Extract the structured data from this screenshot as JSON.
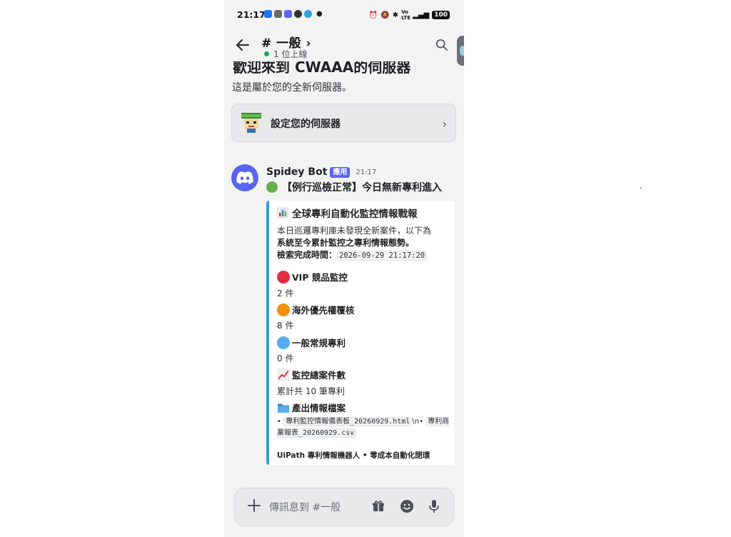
{
  "status_bar": {
    "time": "21:17",
    "battery": "100",
    "signal_text": "Vo LTE",
    "app_colors": [
      "#1877f2",
      "#6b6b6b",
      "#5865f2",
      "#333333",
      "#2aa3e3"
    ]
  },
  "header": {
    "channel": "# 一般 ›",
    "online": "1 位上線"
  },
  "welcome": {
    "title": "歡迎來到 CWAAA的伺服器",
    "subtitle": "這是屬於您的全新伺服器。",
    "setup_label": "設定您的伺服器",
    "setup_chevron": "›"
  },
  "message": {
    "author": "Spidey Bot",
    "badge": "應用",
    "time": "21:17",
    "content": "【例行巡檢正常】今日無新專利進入",
    "status_color": "#6aaf4e"
  },
  "embed": {
    "title": "全球專利自動化監控情報戰報",
    "desc_line1": "本日巡邏專利庫未發現全新案件，以下為",
    "desc_line2": "系統至今累計監控之專利情報態勢。",
    "search_time_label": "檢索完成時間：",
    "search_time_value": "2026-09-29 21:17:20",
    "fields": [
      {
        "name": "VIP 競品監控",
        "value": "2 件",
        "color": "#dd2e44"
      },
      {
        "name": "海外優先權覆核",
        "value": "8 件",
        "color": "#f4900c"
      },
      {
        "name": "一般常規專利",
        "value": "0 件",
        "color": "#55acee"
      },
      {
        "name": "監控總案件數",
        "value": "累計共 10 筆專利",
        "color": "#e23b3b"
      }
    ],
    "files_label": "產出情報檔案",
    "file_bullet": "•",
    "file1": "專利監控情報儀表板_20260929.html",
    "file_sep": "\\n•",
    "file2": "專利商業報表_20260929.csv",
    "footer": "UiPath 專利情報機器人 • 零成本自動化閉環"
  },
  "input": {
    "placeholder": "傳訊息到 #一般"
  }
}
